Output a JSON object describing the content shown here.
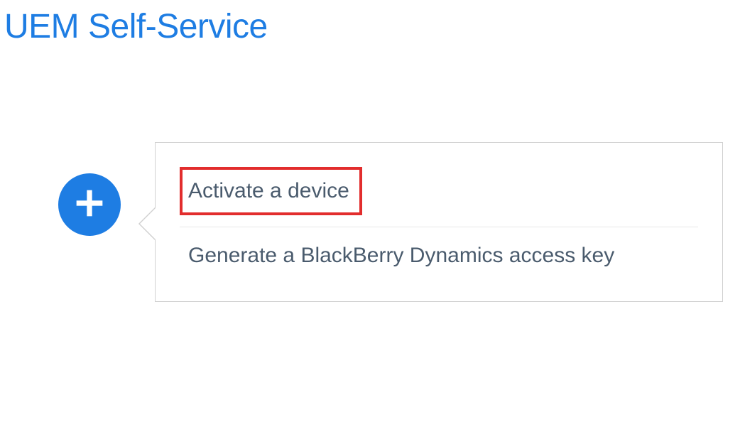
{
  "header": {
    "title": "UEM Self-Service"
  },
  "add_button": {
    "icon": "plus-icon"
  },
  "flyout_menu": {
    "items": [
      {
        "label": "Activate a device"
      },
      {
        "label": "Generate a BlackBerry Dynamics access key"
      }
    ]
  },
  "colors": {
    "accent": "#1e7de3",
    "highlight_border": "#e22d2d",
    "menu_text": "#4a5b6d",
    "flyout_border": "#d0d0d0"
  }
}
